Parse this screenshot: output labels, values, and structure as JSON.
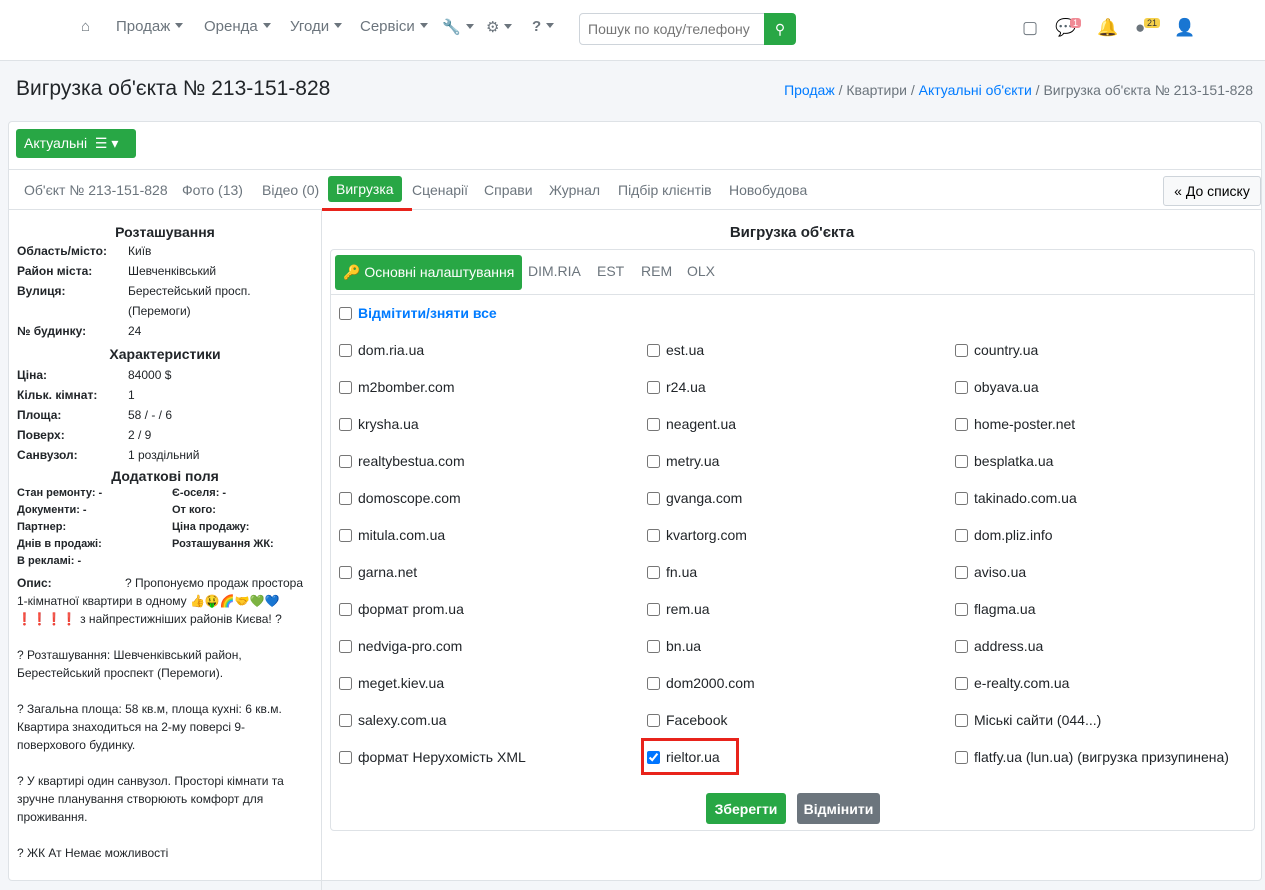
{
  "nav": {
    "items": [
      "Продаж",
      "Оренда",
      "Угоди",
      "Сервіси"
    ],
    "search_placeholder": "Пошук по коду/телефону",
    "messages_badge": "1",
    "alerts_badge": "21"
  },
  "page": {
    "title": "Вигрузка об'єкта № 213-151-828",
    "breadcrumb": [
      "Продаж",
      "Квартири",
      "Актуальні об'єкти",
      "Вигрузка об'єкта № 213-151-828"
    ]
  },
  "toolbar": {
    "status_label": "Актуальні",
    "back_label": "До списку"
  },
  "tabs": [
    "Об'єкт № 213-151-828",
    "Фото (13)",
    "Відео (0)",
    "Вигрузка",
    "Сценарії",
    "Справи",
    "Журнал",
    "Підбір клієнтів",
    "Новобудова"
  ],
  "left": {
    "location_title": "Розташування",
    "location": [
      [
        "Область/місто:",
        "Київ"
      ],
      [
        "Район міста:",
        "Шевченківський"
      ],
      [
        "Вулиця:",
        "Берестейський просп. (Перемоги)"
      ],
      [
        "№ будинку:",
        "24"
      ]
    ],
    "char_title": "Характеристики",
    "chars": [
      [
        "Ціна:",
        "84000 $"
      ],
      [
        "Кільк. кімнат:",
        "1"
      ],
      [
        "Площа:",
        "58 / - / 6"
      ],
      [
        "Поверх:",
        "2 / 9"
      ],
      [
        "Санвузол:",
        "1 роздільний"
      ]
    ],
    "extra_title": "Додаткові поля",
    "extra": [
      "Стан ремонту: -",
      "Є-оселя: -",
      "Документи: -",
      "От кого:",
      "Партнер:",
      "Ціна продажу:",
      "Днів в продажі:",
      "Розташування ЖК:",
      "В рекламі: -",
      ""
    ],
    "desc_label": "Опис:",
    "desc": [
      "? Пропонуємо продаж простора 1-кімнатної квартири в одному 👍🤑🌈🤝💚💙 ❗❗❗❗ з найпрестижніших районів Києва! ?",
      "? Розташування: Шевченківський район, Берестейський проспект (Перемоги).",
      "? Загальна площа: 58 кв.м, площа кухні: 6 кв.м. Квартира знаходиться на 2-му поверсі 9-поверхового будинку.",
      "? У квартирі один санвузол. Просторі кімнати та зручне планування створюють комфорт для проживання.",
      "? ЖК Ат Немає можливості"
    ]
  },
  "export": {
    "title": "Вигрузка об'єкта",
    "tabs": [
      "Основні налаштування",
      "DIM.RIA",
      "EST",
      "REM",
      "OLX"
    ],
    "select_all": "Відмітити/зняти все",
    "columns": [
      [
        "dom.ria.ua",
        "m2bomber.com",
        "krysha.ua",
        "realtybestua.com",
        "domoscope.com",
        "mitula.com.ua",
        "garna.net",
        "формат prom.ua",
        "nedviga-pro.com",
        "meget.kiev.ua",
        "salexy.com.ua",
        "формат Нерухомість XML"
      ],
      [
        "est.ua",
        "r24.ua",
        "neagent.ua",
        "metry.ua",
        "gvanga.com",
        "kvartorg.com",
        "fn.ua",
        "rem.ua",
        "bn.ua",
        "dom2000.com",
        "Facebook",
        "rieltor.ua"
      ],
      [
        "country.ua",
        "obyava.ua",
        "home-poster.net",
        "besplatka.ua",
        "takinado.com.ua",
        "dom.pliz.info",
        "aviso.ua",
        "flagma.ua",
        "address.ua",
        "e-realty.com.ua",
        "Міські сайти (044...)",
        "flatfy.ua (lun.ua) (вигрузка призупинена)"
      ]
    ],
    "checked": "rieltor.ua",
    "save_label": "Зберегти",
    "cancel_label": "Відмінити"
  },
  "colors": {
    "accent": "#28a745",
    "link": "#007bff",
    "highlight": "#e8231b"
  }
}
